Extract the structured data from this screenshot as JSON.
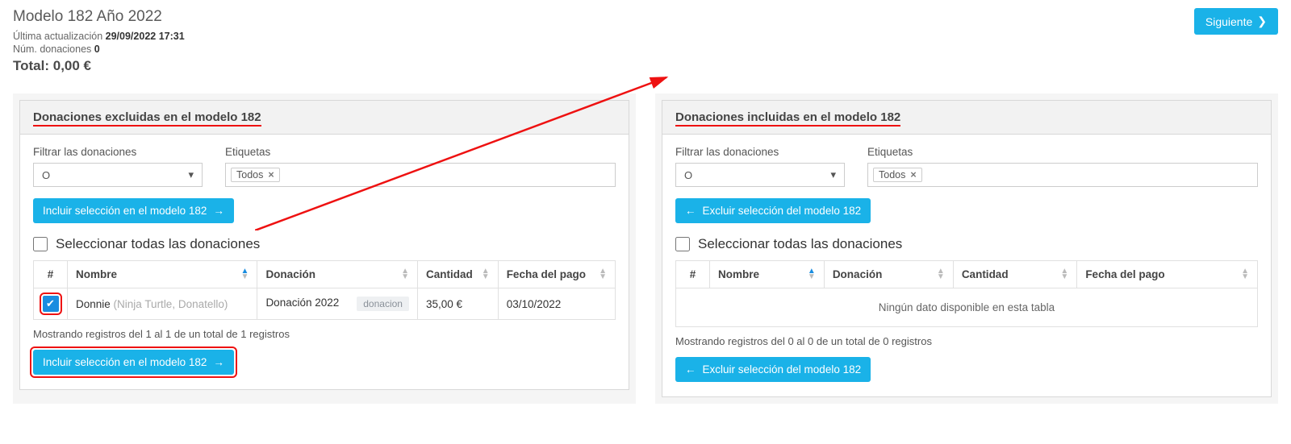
{
  "header": {
    "title": "Modelo 182 Año 2022",
    "last_update_label": "Última actualización",
    "last_update_value": "29/09/2022 17:31",
    "num_donations_label": "Núm. donaciones",
    "num_donations_value": "0",
    "total_label": "Total:",
    "total_value": "0,00 €",
    "next_button": "Siguiente"
  },
  "filters": {
    "filter_label": "Filtrar las donaciones",
    "filter_value": "O",
    "tags_label": "Etiquetas",
    "tag_value": "Todos"
  },
  "columns": {
    "hash": "#",
    "name": "Nombre",
    "donation": "Donación",
    "amount": "Cantidad",
    "payment_date": "Fecha del pago"
  },
  "select_all_label": "Seleccionar todas las donaciones",
  "left": {
    "panel_title": "Donaciones excluidas en el modelo 182",
    "action_button": "Incluir selección en el modelo 182",
    "rows": [
      {
        "name": "Donnie",
        "name_sub": "(Ninja Turtle, Donatello)",
        "donation": "Donación 2022",
        "donation_badge": "donacion",
        "amount": "35,00 €",
        "date": "03/10/2022",
        "checked": true
      }
    ],
    "info": "Mostrando registros del 1 al 1 de un total de 1 registros"
  },
  "right": {
    "panel_title": "Donaciones incluidas en el modelo 182",
    "action_button": "Excluir selección del modelo 182",
    "empty_text": "Ningún dato disponible en esta tabla",
    "info": "Mostrando registros del 0 al 0 de un total de 0 registros"
  }
}
